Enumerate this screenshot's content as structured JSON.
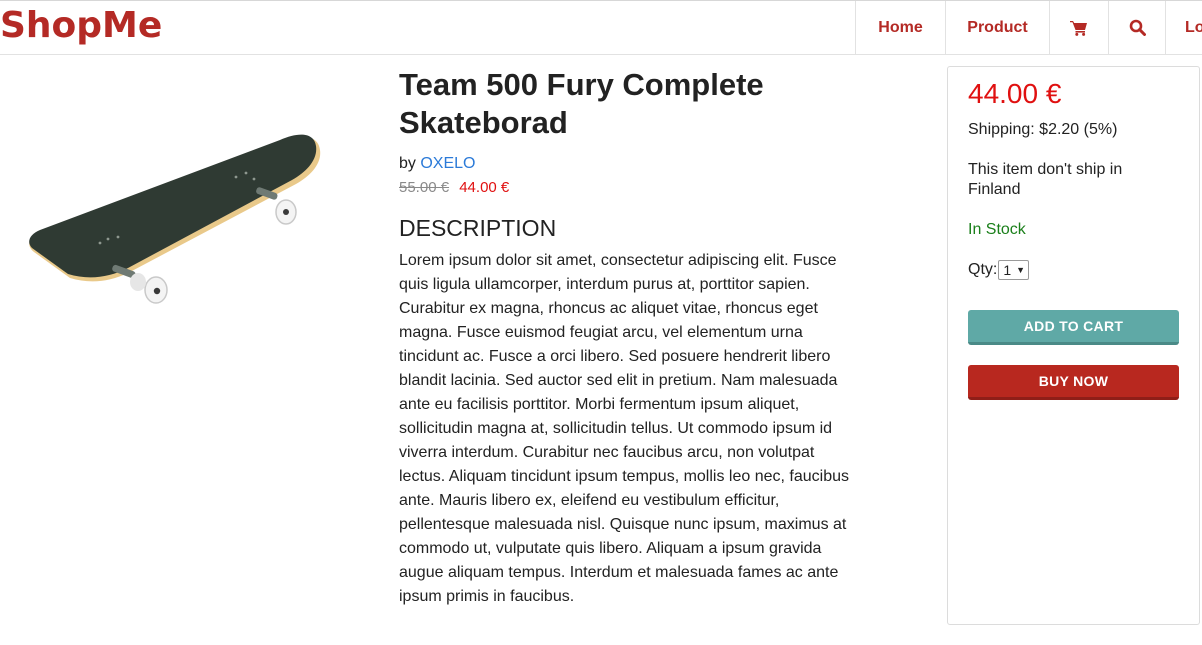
{
  "brand": {
    "name": "ShopMe",
    "color": "#b42a25"
  },
  "nav": {
    "home": "Home",
    "product": "Product",
    "cart_icon": "cart-icon",
    "search_icon": "search-icon",
    "login": "Lo"
  },
  "product": {
    "title": "Team 500 Fury Complete Skateborad",
    "by_label": "by",
    "brand": "OXELO",
    "old_price": "55.00 €",
    "price": "44.00 €",
    "description_heading": "DESCRIPTION",
    "description": "Lorem ipsum dolor sit amet, consectetur adipiscing elit. Fusce quis ligula ullamcorper, interdum purus at, porttitor sapien. Curabitur ex magna, rhoncus ac aliquet vitae, rhoncus eget magna. Fusce euismod feugiat arcu, vel elementum urna tincidunt ac. Fusce a orci libero. Sed posuere hendrerit libero blandit lacinia. Sed auctor sed elit in pretium. Nam malesuada ante eu facilisis porttitor. Morbi fermentum ipsum aliquet, sollicitudin magna at, sollicitudin tellus. Ut commodo ipsum id viverra interdum. Curabitur nec faucibus arcu, non volutpat lectus. Aliquam tincidunt ipsum tempus, mollis leo nec, faucibus ante. Mauris libero ex, eleifend eu vestibulum efficitur, pellentesque malesuada nisl. Quisque nunc ipsum, maximus at commodo ut, vulputate quis libero. Aliquam a ipsum gravida augue aliquam tempus. Interdum et malesuada fames ac ante ipsum primis in faucibus."
  },
  "buy_box": {
    "price": "44.00 €",
    "shipping": "Shipping: $2.20 (5%)",
    "shipping_note": "This item don't ship in Finland",
    "stock": "In Stock",
    "qty_label": "Qty:",
    "qty_value": "1",
    "add_to_cart": "ADD TO CART",
    "buy_now": "BUY NOW"
  },
  "colors": {
    "accent": "#b42a25",
    "link": "#2b7ad8",
    "price": "#e01010",
    "stock": "#1a7f1a",
    "cart_button": "#5fa9a6",
    "buy_button": "#b8281f"
  }
}
